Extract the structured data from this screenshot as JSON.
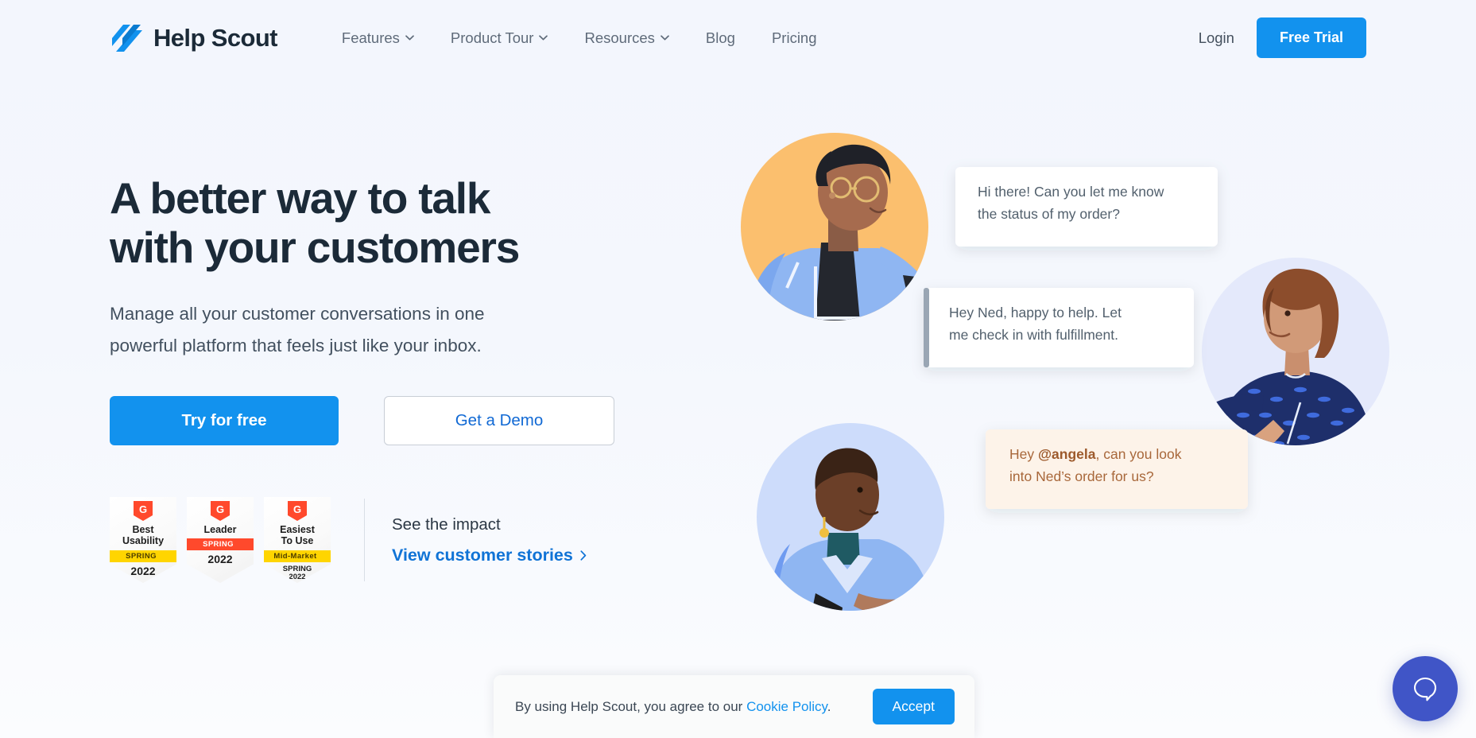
{
  "brand": {
    "name": "Help Scout",
    "logo_icon": "helpscout-logo-icon"
  },
  "nav": {
    "items": [
      {
        "label": "Features",
        "has_caret": true
      },
      {
        "label": "Product Tour",
        "has_caret": true
      },
      {
        "label": "Resources",
        "has_caret": true
      },
      {
        "label": "Blog",
        "has_caret": false
      },
      {
        "label": "Pricing",
        "has_caret": false
      }
    ],
    "login_label": "Login",
    "free_trial_label": "Free Trial"
  },
  "hero": {
    "title_line1": "A better way to talk",
    "title_line2": "with your customers",
    "subtitle_line1": "Manage all your customer conversations in one",
    "subtitle_line2": "powerful platform that feels just like your inbox.",
    "primary_cta": "Try for free",
    "secondary_cta": "Get a Demo"
  },
  "proof": {
    "badges": [
      {
        "mark": "G",
        "title": "Best\nUsability",
        "ribbon": "SPRING",
        "ribbon_style": "yellow",
        "year": "2022",
        "subyear": ""
      },
      {
        "mark": "G",
        "title": "Leader",
        "ribbon": "SPRING",
        "ribbon_style": "red",
        "year": "2022",
        "subyear": ""
      },
      {
        "mark": "G",
        "title": "Easiest\nTo Use",
        "ribbon": "Mid-Market",
        "ribbon_style": "yellow",
        "year": "SPRING",
        "subyear": "2022"
      }
    ],
    "impact_label": "See the impact",
    "impact_link": "View customer stories"
  },
  "illustration": {
    "bubble_customer": "Hi there! Can you let me know the status of my order?",
    "bubble_customer_l1": "Hi there! Can you let me know",
    "bubble_customer_l2": "the status of my order?",
    "bubble_agent_l1": "Hey Ned, happy to help. Let",
    "bubble_agent_l2": "me check in with fulfillment.",
    "bubble_note_prefix": "Hey ",
    "bubble_note_mention": "@angela",
    "bubble_note_rest": ", can you look",
    "bubble_note_l2": "into Ned’s order for us?"
  },
  "cookie": {
    "text_before": "By using Help Scout, you agree to our ",
    "link_label": "Cookie Policy",
    "text_after": ".",
    "accept_label": "Accept"
  },
  "chat_widget": {
    "icon": "chat-bubble-icon",
    "color": "#4055c7"
  },
  "colors": {
    "accent_blue": "#1292ee",
    "link_blue": "#1073d6",
    "heading_navy": "#1b2a38",
    "page_bg": "#f3f6fd",
    "badge_red": "#ff492c",
    "badge_yellow": "#ffd500"
  }
}
